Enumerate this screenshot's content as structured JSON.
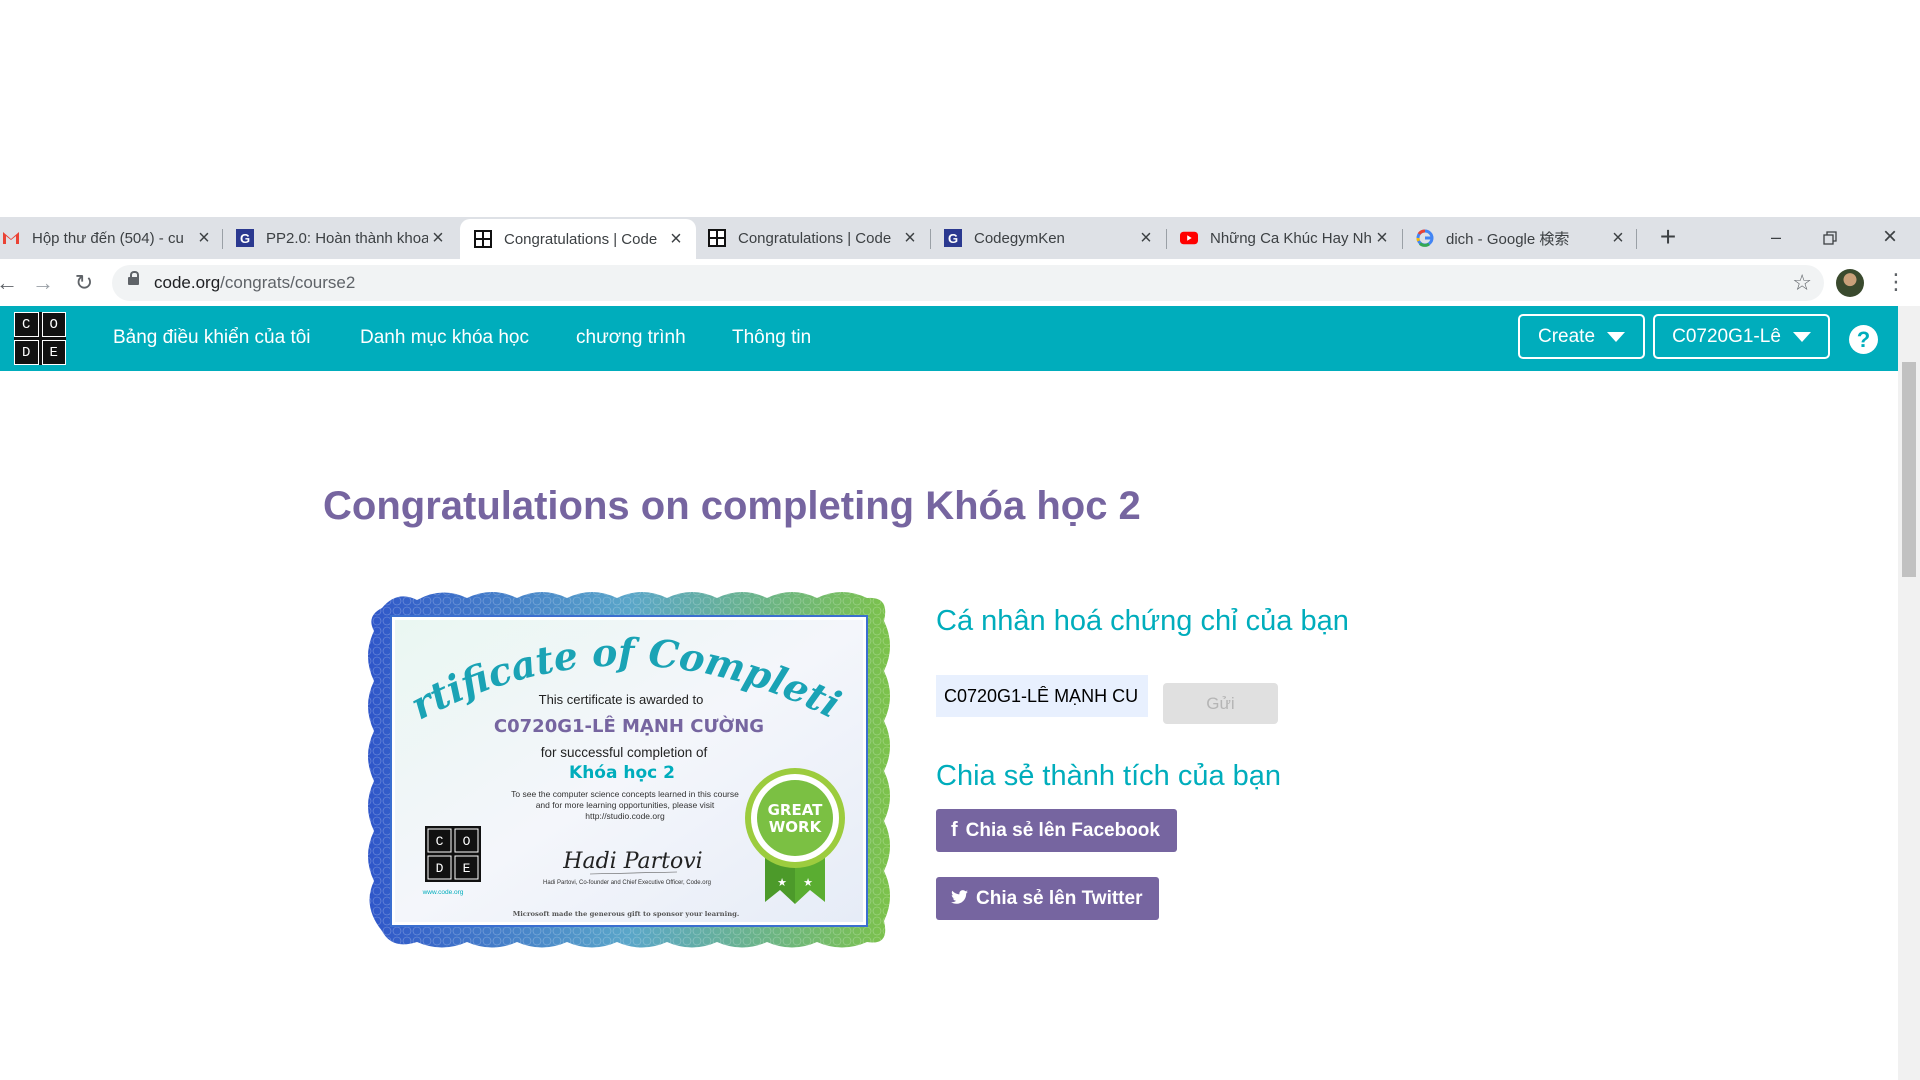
{
  "browser": {
    "tabs": [
      {
        "title": "Hộp thư đến (504) - cu",
        "icon": "gmail-icon",
        "active": false
      },
      {
        "title": "PP2.0: Hoàn thành khoa",
        "icon": "codegym-icon",
        "active": false
      },
      {
        "title": "Congratulations | Code",
        "icon": "codeorg-icon",
        "active": true
      },
      {
        "title": "Congratulations | Code",
        "icon": "codeorg-icon",
        "active": false
      },
      {
        "title": "CodegymKen",
        "icon": "codegym-icon",
        "active": false
      },
      {
        "title": "Những Ca Khúc Hay Nh",
        "icon": "youtube-icon",
        "active": false
      },
      {
        "title": "dich - Google 検索",
        "icon": "google-icon",
        "active": false
      }
    ],
    "address": {
      "domain": "code.org",
      "path": "/congrats/course2"
    }
  },
  "site": {
    "logo_letters": [
      "C",
      "O",
      "D",
      "E"
    ],
    "nav": [
      "Bảng điều khiển của tôi",
      "Danh mục khóa học",
      "chương trình",
      "Thông tin"
    ],
    "create_label": "Create",
    "user_label": "C0720G1-Lê",
    "help_label": "?"
  },
  "main": {
    "heading": "Congratulations on completing Khóa học 2",
    "personalize_heading": "Cá nhân hoá chứng chỉ của bạn",
    "name_value": "C0720G1-LÊ MẠNH CU",
    "submit_label": "Gửi",
    "share_heading": "Chia sẻ thành tích của bạn",
    "facebook_label": "Chia sẻ lên Facebook",
    "twitter_label": "Chia sẻ lên Twitter"
  },
  "certificate": {
    "title": "Certificate of Completion",
    "awarded": "This certificate is awarded to",
    "recipient": "C0720G1-LÊ MẠNH CƯỜNG",
    "for": "for successful completion of",
    "course": "Khóa học 2",
    "info1": "To see the computer science concepts learned in this course",
    "info2": "and for more learning opportunities, please visit",
    "info3": "http://studio.code.org",
    "signature": "Hadi Partovi",
    "signer": "Hadi Partovi, Co-founder and Chief Executive Officer, Code.org",
    "footer": "Microsoft made the generous gift to sponsor your learning.",
    "site": "www.code.org",
    "seal_big": "GREAT",
    "seal_big2": "WORK",
    "seal_ring": "ANYONE CAN LEARN COMPUTER SCIENCE"
  },
  "colors": {
    "teal": "#00adbc",
    "purple": "#7665a0",
    "seal_green": "#7bc043"
  }
}
